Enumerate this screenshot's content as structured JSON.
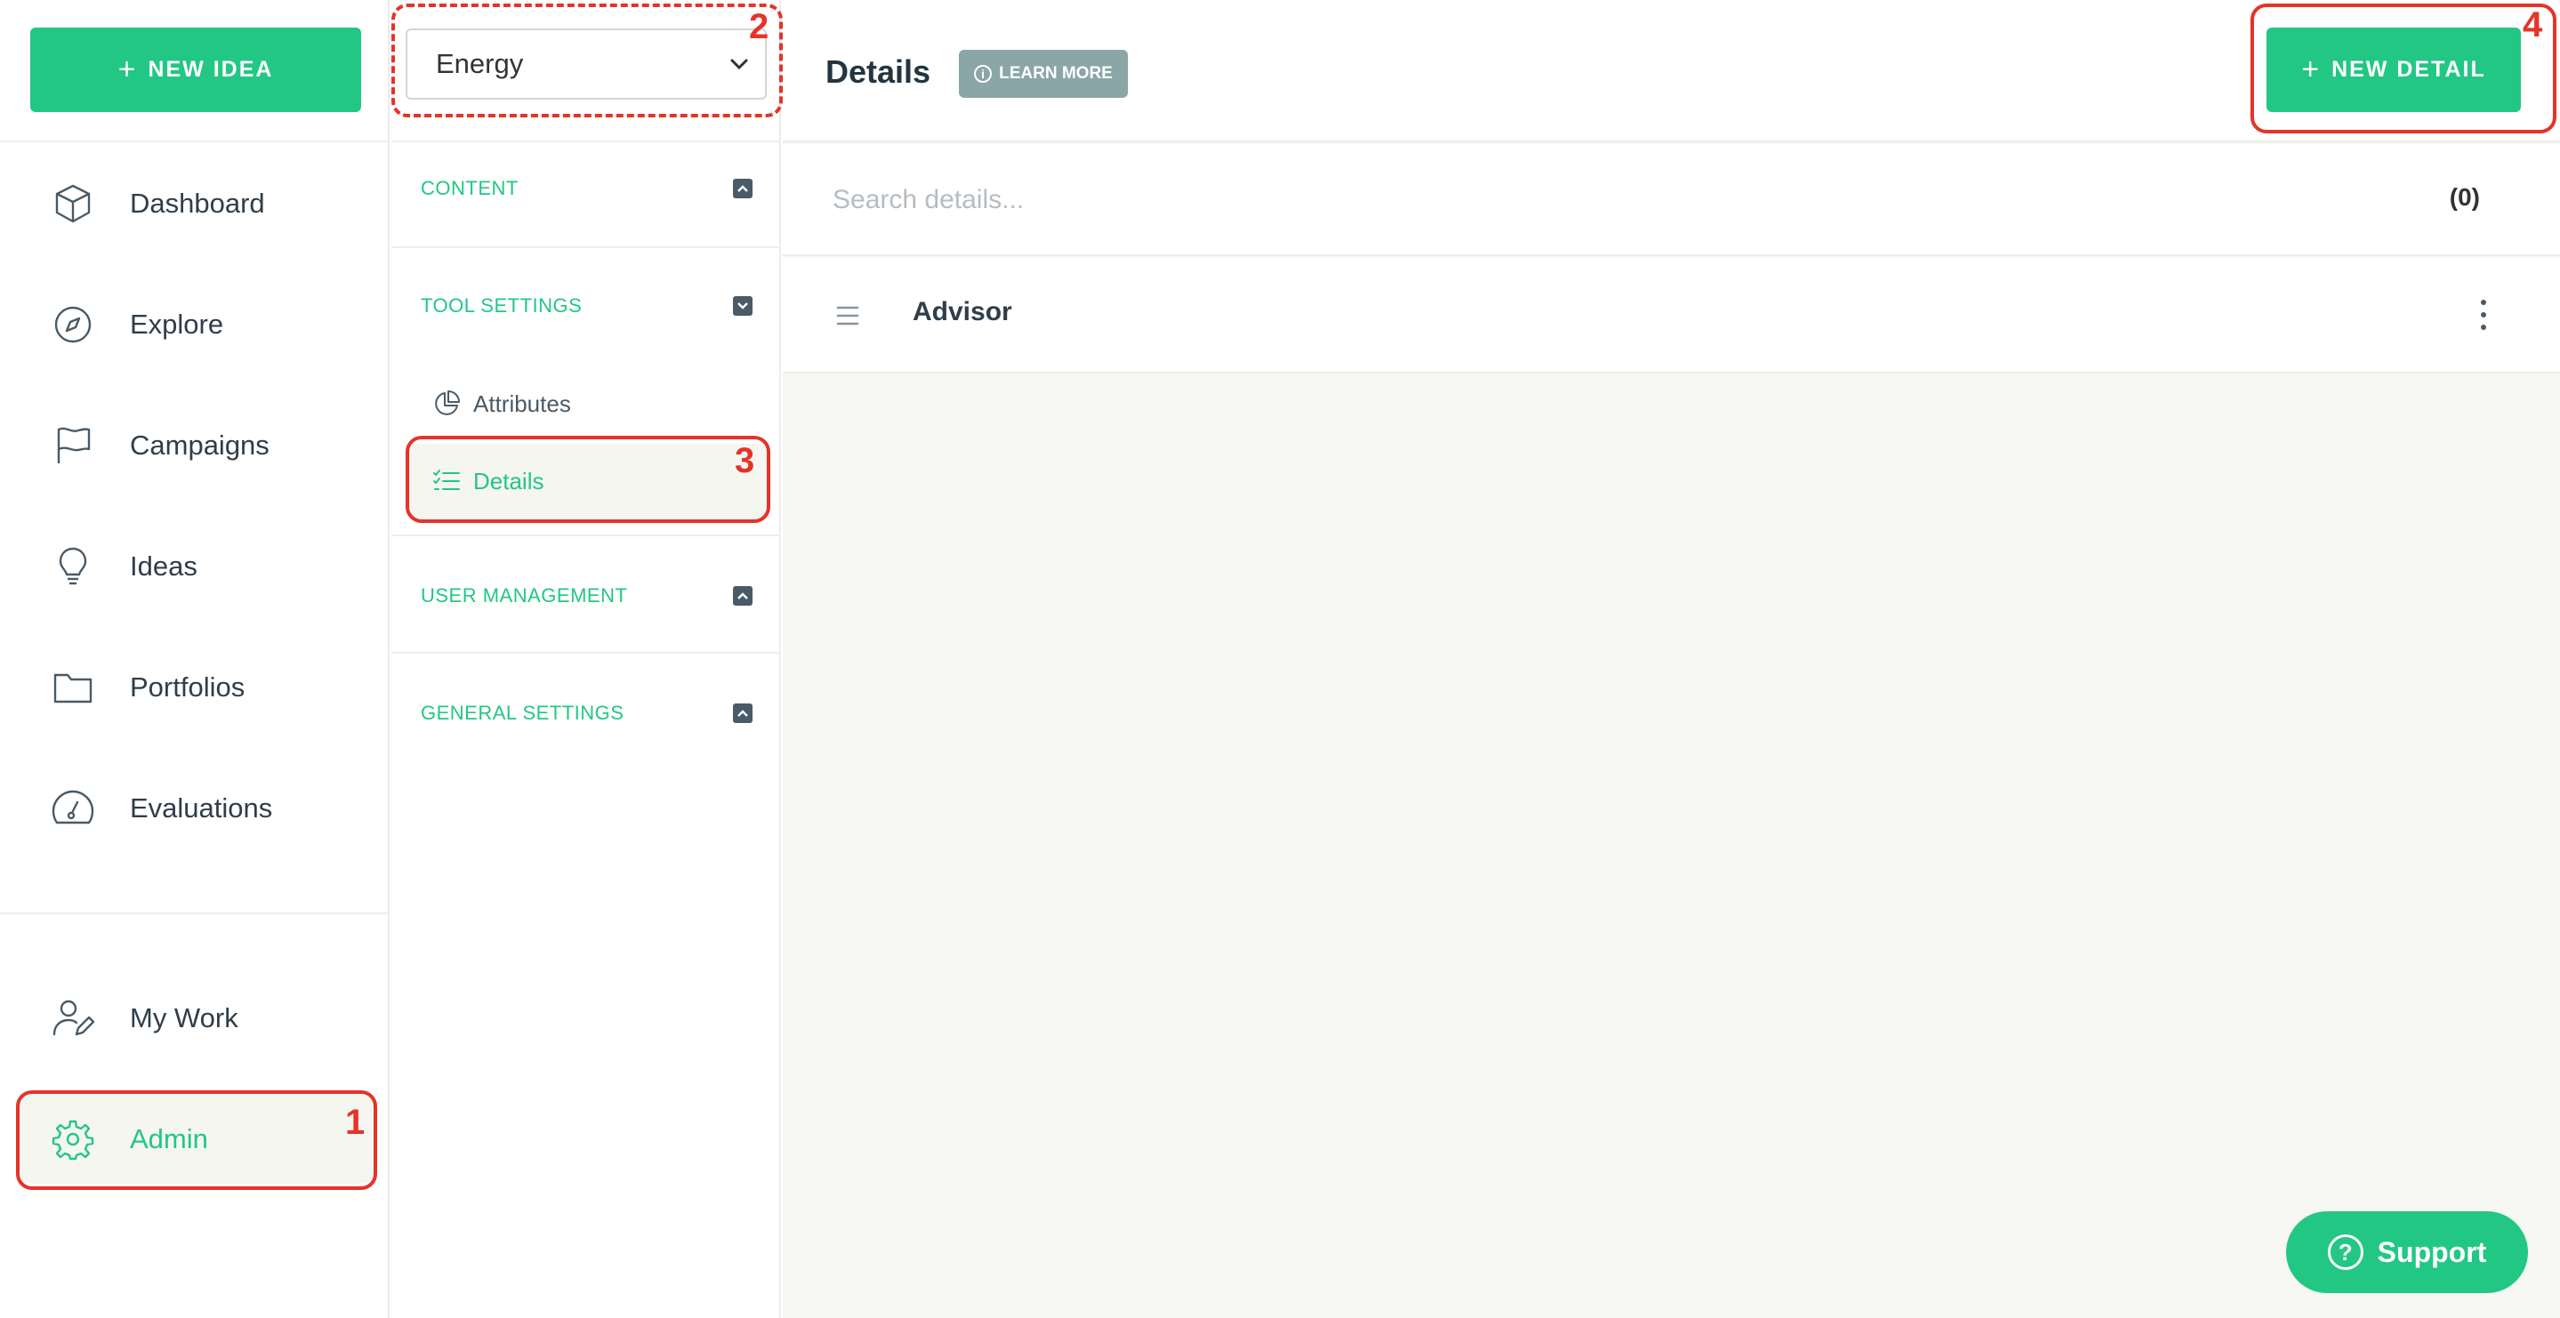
{
  "sidebar": {
    "new_idea_label": "NEW IDEA",
    "nav_items": [
      {
        "label": "Dashboard",
        "icon": "cube-icon"
      },
      {
        "label": "Explore",
        "icon": "compass-icon"
      },
      {
        "label": "Campaigns",
        "icon": "flag-icon"
      },
      {
        "label": "Ideas",
        "icon": "lightbulb-icon"
      },
      {
        "label": "Portfolios",
        "icon": "folder-icon"
      },
      {
        "label": "Evaluations",
        "icon": "gauge-icon"
      }
    ],
    "bottom_items": [
      {
        "label": "My Work",
        "icon": "user-edit-icon"
      },
      {
        "label": "Admin",
        "icon": "gear-icon",
        "active": true
      }
    ]
  },
  "panel": {
    "selected_org": "Energy",
    "sections": [
      {
        "title": "CONTENT",
        "state": "collapsed"
      },
      {
        "title": "TOOL SETTINGS",
        "state": "expanded"
      },
      {
        "title": "USER MANAGEMENT",
        "state": "collapsed"
      },
      {
        "title": "GENERAL SETTINGS",
        "state": "collapsed"
      }
    ],
    "tool_settings_items": [
      {
        "label": "Attributes",
        "icon": "pie-chart-icon"
      },
      {
        "label": "Details",
        "icon": "checklist-icon",
        "active": true
      }
    ]
  },
  "main": {
    "title": "Details",
    "learn_more_label": "LEARN MORE",
    "new_detail_label": "NEW DETAIL",
    "search_placeholder": "Search details...",
    "count": "(0)",
    "details": [
      {
        "name": "Advisor"
      }
    ]
  },
  "support_label": "Support",
  "annotations": [
    "1",
    "2",
    "3",
    "4"
  ],
  "colors": {
    "accent": "#22c784",
    "annotation": "#e53329",
    "badge": "#8aa6a6"
  }
}
